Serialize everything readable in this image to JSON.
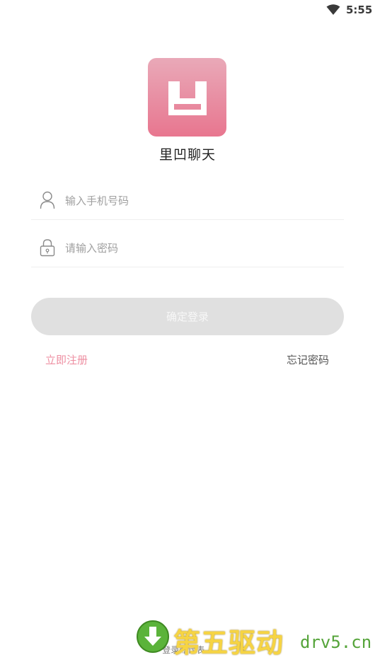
{
  "status_bar": {
    "time": "5:55",
    "wifi_icon": "wifi-icon"
  },
  "app": {
    "name": "里凹聊天",
    "logo_glyph": "凹"
  },
  "form": {
    "phone_placeholder": "输入手机号码",
    "password_placeholder": "请输入密码",
    "phone_icon": "user-icon",
    "password_icon": "lock-icon",
    "submit_label": "确定登录"
  },
  "links": {
    "register": "立即注册",
    "forgot": "忘记密码"
  },
  "footer": {
    "agreement": "登录即代表..."
  },
  "watermark": {
    "text_cn": "第五驱动",
    "text_en": "drv5.cn"
  },
  "colors": {
    "accent_pink": "#ee8fa2",
    "logo_gradient_top": "#e9a9b8",
    "logo_gradient_bottom": "#e8768f",
    "button_disabled": "#e0e0e0"
  }
}
